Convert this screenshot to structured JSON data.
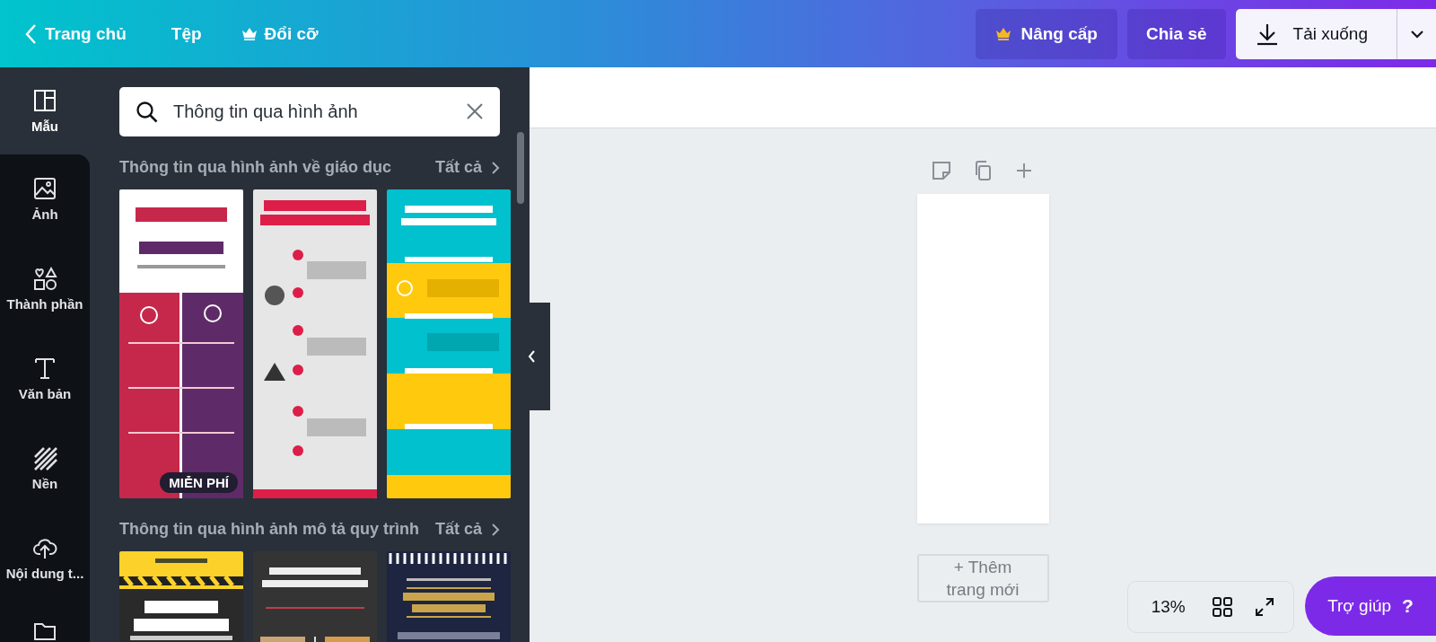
{
  "topbar": {
    "back": "Trang chủ",
    "menu": [
      {
        "label": "Tệp",
        "premium": false
      },
      {
        "label": "Đổi cỡ",
        "premium": true
      }
    ],
    "actions": [
      {
        "kind": "upgrade",
        "label": "Nâng cấp"
      },
      {
        "kind": "share",
        "label": "Chia sẻ"
      },
      {
        "kind": "download",
        "label": "Tải xuống"
      }
    ]
  },
  "rail": [
    {
      "kind": "templates",
      "label": "Mẫu",
      "selected": true
    },
    {
      "kind": "photos",
      "label": "Ảnh",
      "selected": false
    },
    {
      "kind": "elements",
      "label": "Thành phần",
      "selected": false
    },
    {
      "kind": "text",
      "label": "Văn bản",
      "selected": false
    },
    {
      "kind": "background",
      "label": "Nền",
      "selected": false
    },
    {
      "kind": "uploads",
      "label": "Nội dung t...",
      "selected": false
    },
    {
      "kind": "folder",
      "selected": false
    }
  ],
  "search": {
    "value": "Thông tin qua hình ảnh"
  },
  "sections": [
    {
      "title": "Thông tin qua hình ảnh về giáo dục",
      "link": "Tất cả",
      "templates": [
        {
          "kind": "picture",
          "badge": "MIỄN PHÍ"
        },
        {
          "kind": "picture"
        },
        {
          "kind": "picture"
        }
      ]
    },
    {
      "title": "Thông tin qua hình ảnh mô tả quy trình",
      "link": "Tất cả",
      "templates": [
        {
          "kind": "picture"
        },
        {
          "kind": "picture"
        },
        {
          "kind": "picture"
        }
      ]
    }
  ],
  "canvas": {
    "add_page": "+ Thêm trang mới",
    "zoom": "13%"
  },
  "help": {
    "label": "Trợ giúp",
    "mark": "?"
  }
}
